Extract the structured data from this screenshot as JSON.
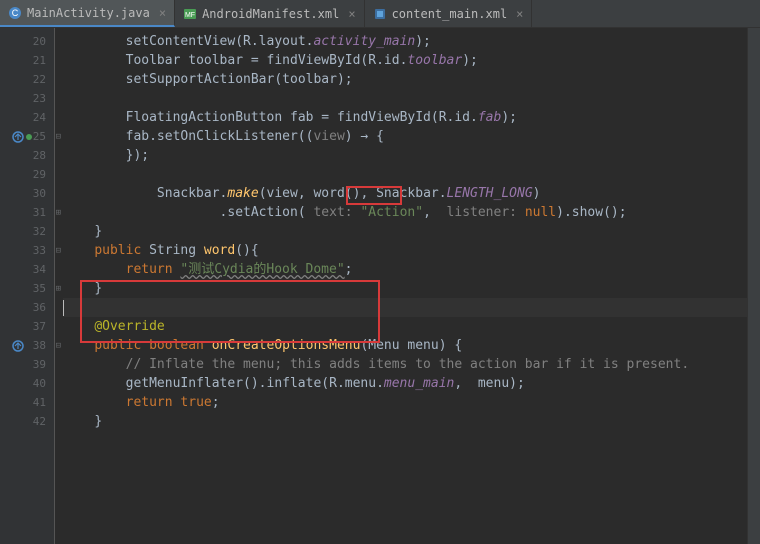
{
  "tabs": [
    {
      "label": "MainActivity.java",
      "icon_color": "#4a88c7",
      "icon_letter": "C",
      "active": true
    },
    {
      "label": "AndroidManifest.xml",
      "icon_color": "#499c54",
      "icon_letter": "M",
      "active": false
    },
    {
      "label": "content_main.xml",
      "icon_color": "#4a88c7",
      "icon_letter": "◆",
      "active": false
    }
  ],
  "line_numbers": [
    "20",
    "21",
    "22",
    "23",
    "24",
    "25",
    "28",
    "29",
    "30",
    "31",
    "32",
    "33",
    "34",
    "35",
    "36",
    "37",
    "38",
    "39",
    "40",
    "41",
    "42"
  ],
  "code": {
    "l20": {
      "method": "setContentView",
      "res": "R.layout.",
      "field": "activity_main"
    },
    "l21": {
      "type": "Toolbar",
      "var": "toolbar = findViewById(R.id.",
      "field": "toolbar"
    },
    "l22": {
      "method": "setSupportActionBar",
      "arg": "(toolbar);"
    },
    "l24": {
      "type": "FloatingActionButton",
      "var": "fab = findViewById(R.id.",
      "field": "fab"
    },
    "l25": {
      "obj": "fab.setOnClickListener((",
      "param": "view",
      "rest": ") → {"
    },
    "l28": {
      "cls": "Snackbar.",
      "method": "make",
      "args1": "(view, ",
      "call": "word()",
      "args2": ", Snackbar.",
      "const": "LENGTH_LONG",
      "end": ")"
    },
    "l29": {
      "method": ".setAction(",
      "hint1": " text: ",
      "str": "\"Action\"",
      "comma": ", ",
      "hint2": " listener: ",
      "null": "null",
      "end": ").show();"
    },
    "l30": {
      "text": "});"
    },
    "l32": {
      "brace": "}"
    },
    "l33": {
      "mod": "public",
      "type": "String",
      "name": "word",
      "sig": "(){"
    },
    "l34": {
      "kw": "return",
      "str": "\"测试Cydia的Hook Dome\"",
      "semi": ";"
    },
    "l35": {
      "brace": "}"
    },
    "l37": {
      "anno": "@Override"
    },
    "l38": {
      "mod": "public boolean",
      "name": "onCreateOptionsMenu",
      "args": "(Menu menu) {"
    },
    "l39": {
      "comment": "// Inflate the menu; this adds items to the action bar if it is present."
    },
    "l40": {
      "call": "getMenuInflater().inflate(R.menu.",
      "field": "menu_main",
      "end": ",  menu);"
    },
    "l41": {
      "kw": "return true",
      "semi": ";"
    },
    "l42": {
      "brace": "}"
    }
  }
}
